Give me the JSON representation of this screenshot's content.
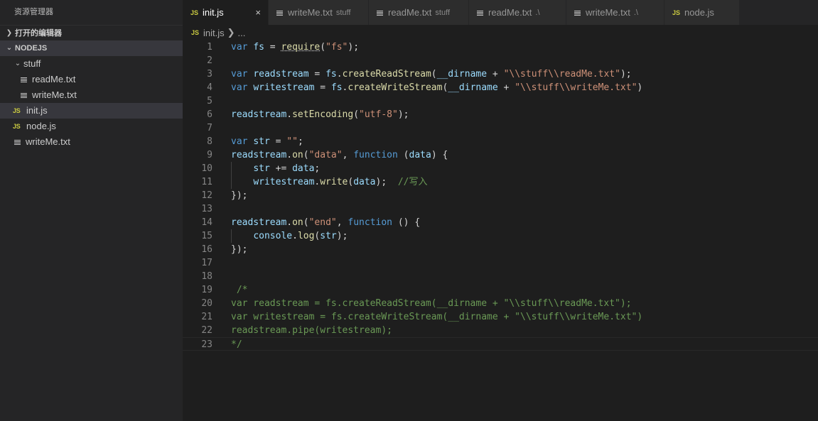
{
  "sidebar": {
    "title": "资源管理器",
    "open_editors_label": "打开的编辑器",
    "workspace_label": "NODEJS",
    "folder": "stuff",
    "folder_files": [
      "readMe.txt",
      "writeMe.txt"
    ],
    "root_files": [
      {
        "name": "init.js",
        "type": "js",
        "selected": true
      },
      {
        "name": "node.js",
        "type": "js",
        "selected": false
      },
      {
        "name": "writeMe.txt",
        "type": "txt",
        "selected": false
      }
    ]
  },
  "tabs": [
    {
      "label": "init.js",
      "desc": "",
      "type": "js",
      "active": true
    },
    {
      "label": "writeMe.txt",
      "desc": "stuff",
      "type": "txt",
      "active": false
    },
    {
      "label": "readMe.txt",
      "desc": "stuff",
      "type": "txt",
      "active": false
    },
    {
      "label": "readMe.txt",
      "desc": ".\\",
      "type": "txt",
      "active": false
    },
    {
      "label": "writeMe.txt",
      "desc": ".\\",
      "type": "txt",
      "active": false
    },
    {
      "label": "node.js",
      "desc": "",
      "type": "js",
      "active": false
    }
  ],
  "breadcrumb": {
    "file": "init.js",
    "rest": "..."
  },
  "icons": {
    "js_badge": "JS",
    "close": "×",
    "chevron_right": "❯",
    "chevron_down": "⌄"
  },
  "code_lines": [
    "var fs = require(\"fs\");",
    "",
    "var readstream = fs.createReadStream(__dirname + \"\\\\stuff\\\\readMe.txt\");",
    "var writestream = fs.createWriteStream(__dirname + \"\\\\stuff\\\\writeMe.txt\")",
    "",
    "readstream.setEncoding(\"utf-8\");",
    "",
    "var str = \"\";",
    "readstream.on(\"data\", function (data) {",
    "    str += data;",
    "    writestream.write(data);  //写入",
    "});",
    "",
    "readstream.on(\"end\", function () {",
    "    console.log(str);",
    "});",
    "",
    "",
    " /*",
    "var readstream = fs.createReadStream(__dirname + \"\\\\stuff\\\\readMe.txt\");",
    "var writestream = fs.createWriteStream(__dirname + \"\\\\stuff\\\\writeMe.txt\")",
    "readstream.pipe(writestream);",
    "*/"
  ],
  "current_line": 23,
  "colors": {
    "keyword": "#569cd6",
    "variable": "#9cdcfe",
    "function": "#dcdcaa",
    "string": "#ce9178",
    "comment": "#6a9955",
    "js_icon": "#cbcb41"
  }
}
